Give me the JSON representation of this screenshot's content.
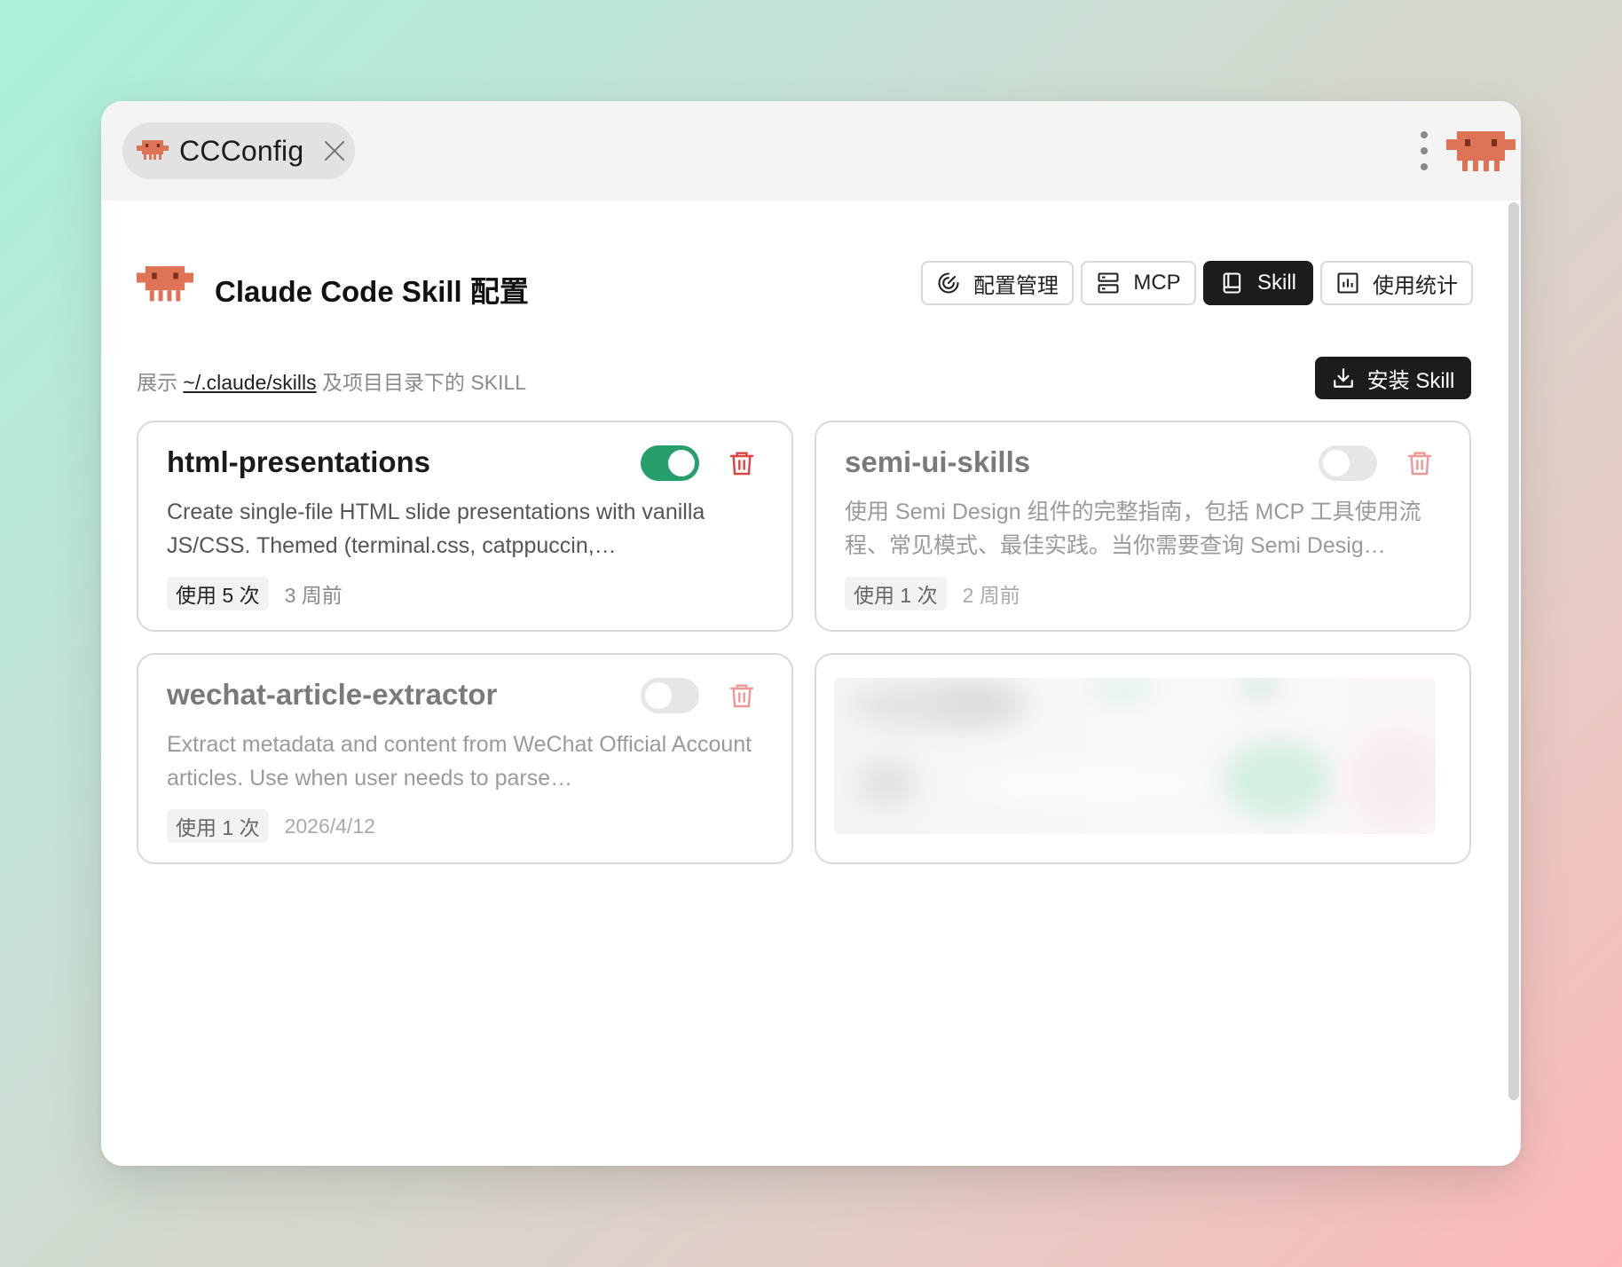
{
  "window": {
    "tab": {
      "label": "CCConfig"
    }
  },
  "header": {
    "title": "Claude Code Skill 配置"
  },
  "nav": [
    {
      "label": "配置管理",
      "icon": "gauge-icon",
      "active": false
    },
    {
      "label": "MCP",
      "icon": "server-icon",
      "active": false
    },
    {
      "label": "Skill",
      "icon": "book-icon",
      "active": true
    },
    {
      "label": "使用统计",
      "icon": "bar-chart-icon",
      "active": false
    }
  ],
  "description": {
    "prefix": "展示",
    "path": "~/.claude/skills",
    "suffix": "及项目目录下的 SKILL"
  },
  "install_button": {
    "label": "安装 Skill",
    "icon": "download-icon"
  },
  "skills": [
    {
      "name": "html-presentations",
      "enabled": true,
      "description": "Create single-file HTML slide presentations with vanilla JS/CSS. Themed (terminal.css, catppuccin,…",
      "usage": "使用 5 次",
      "time": "3 周前"
    },
    {
      "name": "semi-ui-skills",
      "enabled": false,
      "description": "使用 Semi Design 组件的完整指南，包括 MCP 工具使用流程、常见模式、最佳实践。当你需要查询 Semi Desig…",
      "usage": "使用 1 次",
      "time": "2 周前"
    },
    {
      "name": "wechat-article-extractor",
      "enabled": false,
      "description": "Extract metadata and content from WeChat Official Account articles. Use when user needs to parse…",
      "usage": "使用 1 次",
      "time": "2026/4/12"
    }
  ],
  "colors": {
    "accent": "#25a06a",
    "brand": "#de7356",
    "danger": "#e0413e",
    "dark": "#1c1c1c"
  }
}
